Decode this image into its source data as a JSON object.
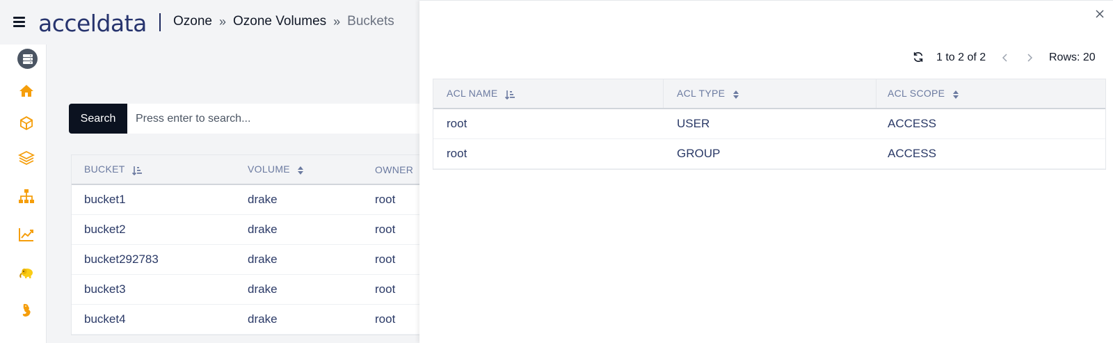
{
  "brand": {
    "logo_bold": "accel",
    "logo_light": "data"
  },
  "breadcrumb": {
    "items": [
      "Ozone",
      "Ozone Volumes",
      "Buckets"
    ],
    "separator": "»"
  },
  "sidebar": {
    "icons": [
      "servers-icon",
      "home-icon",
      "cube-icon",
      "layers-icon",
      "sitemap-icon",
      "chart-line-icon",
      "hadoop-elephant-icon",
      "hive-icon"
    ]
  },
  "search": {
    "button_label": "Search",
    "placeholder": "Press enter to search..."
  },
  "bucket_table": {
    "headers": [
      "BUCKET",
      "VOLUME",
      "OWNER"
    ],
    "rows": [
      [
        "bucket1",
        "drake",
        "root"
      ],
      [
        "bucket2",
        "drake",
        "root"
      ],
      [
        "bucket292783",
        "drake",
        "root"
      ],
      [
        "bucket3",
        "drake",
        "root"
      ],
      [
        "bucket4",
        "drake",
        "root"
      ]
    ]
  },
  "acl_panel": {
    "pagination_text": "1 to 2 of 2",
    "rows_text": "Rows: 20",
    "headers": [
      "ACL NAME",
      "ACL TYPE",
      "ACL SCOPE"
    ],
    "rows": [
      [
        "root",
        "USER",
        "ACCESS"
      ],
      [
        "root",
        "GROUP",
        "ACCESS"
      ]
    ]
  },
  "colors": {
    "accent_orange": "#f59e0b",
    "brand_navy": "#1e2a5e",
    "search_button": "#0b1220",
    "cell_text": "#2b3a67",
    "header_text": "#6b7aa0"
  }
}
